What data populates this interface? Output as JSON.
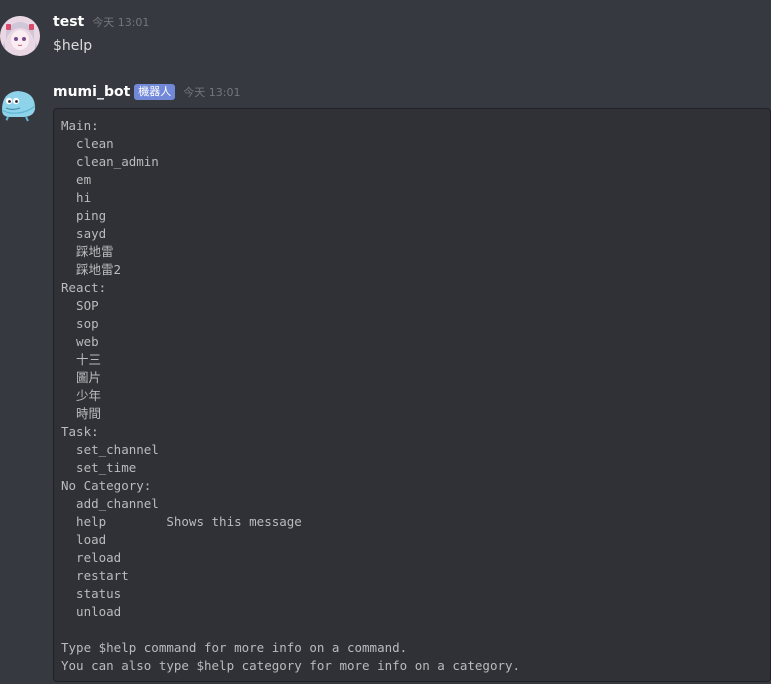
{
  "messages": [
    {
      "username": "test",
      "timestamp": "今天 13:01",
      "content": "$help",
      "avatar": "anime-girl-avatar"
    },
    {
      "username": "mumi_bot",
      "bot_tag": "機器人",
      "timestamp": "今天 13:01",
      "avatar": "mumi-creature-avatar",
      "code_lines": [
        "Main:",
        "  clean",
        "  clean_admin",
        "  em",
        "  hi",
        "  ping",
        "  sayd",
        "  踩地雷",
        "  踩地雷2",
        "React:",
        "  SOP",
        "  sop",
        "  web",
        "  十三",
        "  圖片",
        "  少年",
        "  時間",
        "Task:",
        "  set_channel",
        "  set_time",
        "No Category:",
        "  add_channel",
        "  help        Shows this message",
        "  load",
        "  reload",
        "  restart",
        "  status",
        "  unload",
        "",
        "Type $help command for more info on a command.",
        "You can also type $help category for more info on a category."
      ]
    }
  ],
  "colors": {
    "background": "#36393f",
    "codeblock_bg": "#2f3136",
    "bot_tag": "#7289da",
    "username": "#ffffff",
    "timestamp": "#72767d",
    "code_text": "#b9bbbe"
  }
}
